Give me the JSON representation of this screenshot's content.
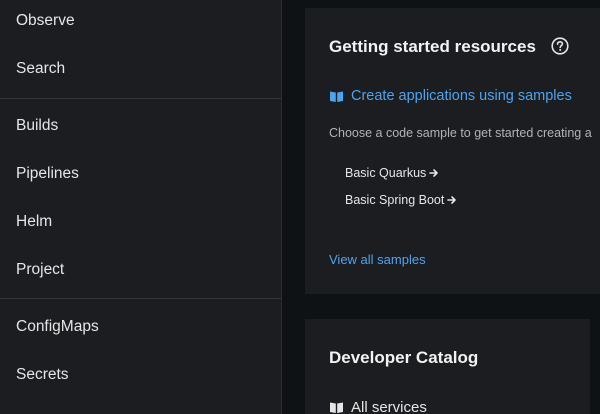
{
  "sidebar": {
    "items": [
      {
        "label": "Observe"
      },
      {
        "label": "Search"
      },
      {
        "label": "Builds"
      },
      {
        "label": "Pipelines"
      },
      {
        "label": "Helm"
      },
      {
        "label": "Project"
      },
      {
        "label": "ConfigMaps"
      },
      {
        "label": "Secrets"
      }
    ]
  },
  "getting_started": {
    "title": "Getting started resources",
    "link_label": "Create applications using samples",
    "description": "Choose a code sample to get started creating a",
    "samples": [
      {
        "label": "Basic Quarkus"
      },
      {
        "label": "Basic Spring Boot"
      }
    ],
    "view_all_label": "View all samples"
  },
  "developer_catalog": {
    "title": "Developer Catalog",
    "all_services_label": "All services"
  },
  "colors": {
    "sidebar_bg": "#1b1d21",
    "page_bg": "#0f1214",
    "link": "#4da3f0",
    "text": "#e6e6e6"
  }
}
